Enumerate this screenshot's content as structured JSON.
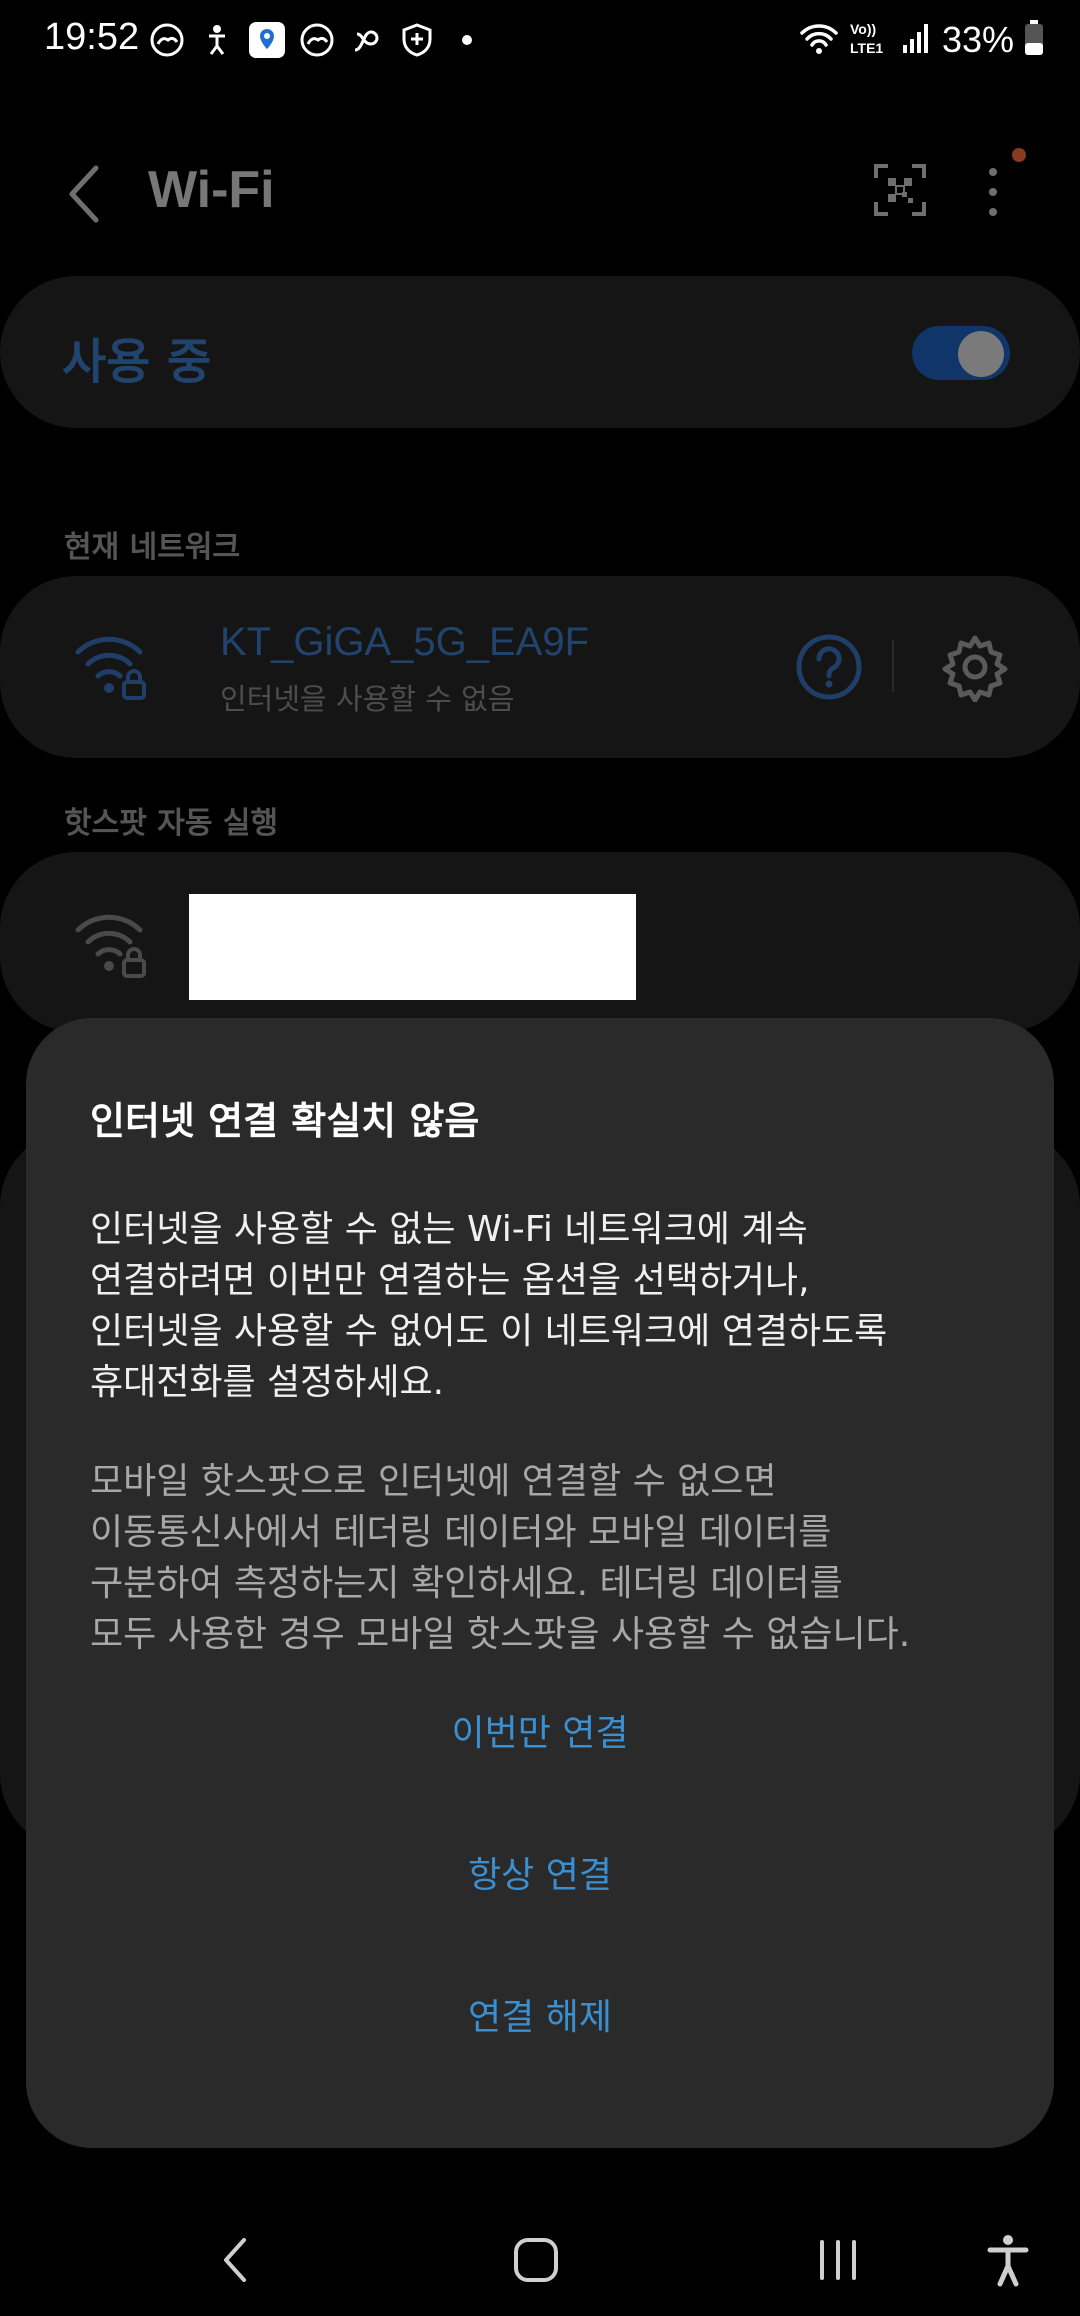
{
  "status_bar": {
    "time": "19:52",
    "battery": "33%",
    "notification_icons": [
      "weather-icon",
      "accessibility-person-icon",
      "map-pin-app-icon",
      "weather-icon",
      "link-icon",
      "shield-plus-icon",
      "dot-icon"
    ],
    "system_icons": [
      "wifi-icon",
      "volte-lte-icon",
      "signal-icon",
      "battery-icon"
    ],
    "volte_label": "Vo)) LTE1"
  },
  "app_bar": {
    "title": "Wi-Fi"
  },
  "wifi_toggle": {
    "label": "사용 중",
    "on": true
  },
  "current_network": {
    "section": "현재 네트워크",
    "name": "KT_GiGA_5G_EA9F",
    "status": "인터넷을 사용할 수 없음"
  },
  "hotspot": {
    "section": "핫스팟 자동 실행"
  },
  "dialog": {
    "title": "인터넷 연결 확실치 않음",
    "body_lines": [
      "인터넷을 사용할 수 없는 Wi-Fi 네트워크에 계속",
      "연결하려면 이번만 연결하는 옵션을 선택하거나,",
      "인터넷을 사용할 수 없어도 이 네트워크에 연결하도록",
      "휴대전화를 설정하세요."
    ],
    "note_lines": [
      "모바일 핫스팟으로 인터넷에 연결할 수 없으면",
      "이동통신사에서 테더링 데이터와 모바일 데이터를",
      "구분하여 측정하는지 확인하세요. 테더링 데이터를",
      "모두 사용한 경우 모바일 핫스팟을 사용할 수 없습니다."
    ],
    "buttons": {
      "connect_once": "이번만 연결",
      "always_connect": "항상 연결",
      "disconnect": "연결 해제"
    }
  },
  "colors": {
    "background": "#000000",
    "card": "#151515",
    "dialog": "#2a2a2a",
    "accent": "#3b8fd0"
  }
}
